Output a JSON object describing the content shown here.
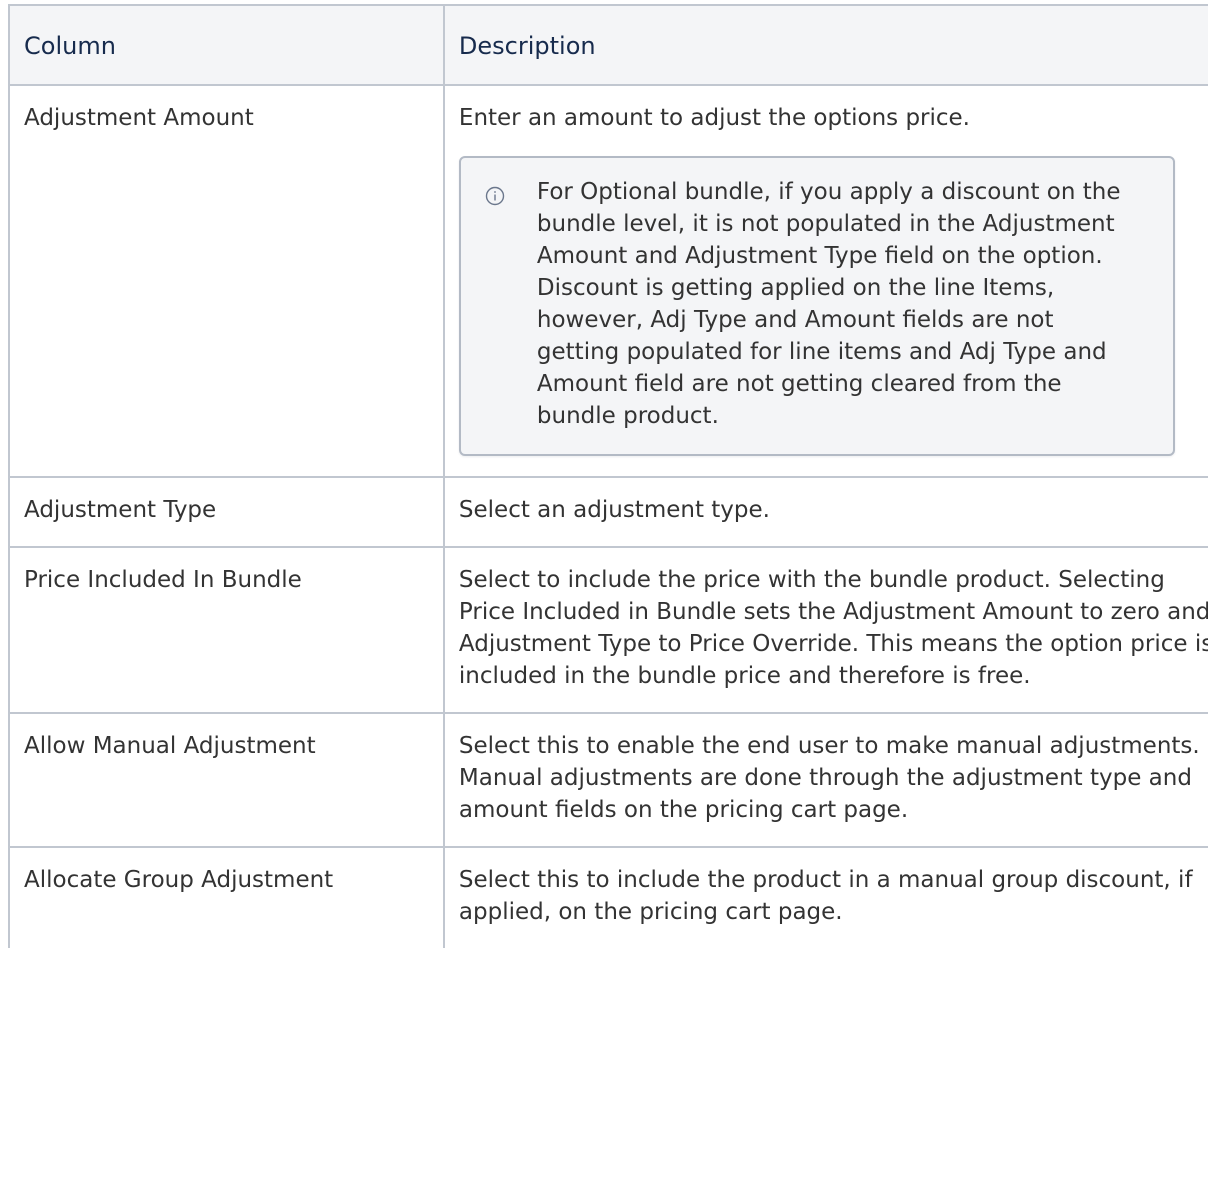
{
  "table": {
    "headers": [
      "Column",
      "Description"
    ],
    "rows": [
      {
        "column": "Adjustment Amount",
        "description": "Enter an amount to adjust the options price.",
        "note": {
          "icon": "info-icon",
          "paragraphs": [
            "For Optional bundle, if you apply a discount on the bundle level, it is not populated in the Adjustment Amount and Adjustment Type field on the option.",
            "Discount is getting applied on the line Items, however, Adj Type and Amount fields are not getting populated for line items and Adj Type and Amount field are not getting cleared from the bundle product."
          ]
        }
      },
      {
        "column": "Adjustment Type",
        "description": "Select an adjustment type."
      },
      {
        "column": "Price Included In Bundle",
        "description": "Select to include the price with the bundle product. Selecting Price Included in Bundle sets the Adjustment Amount to zero and Adjustment Type to Price Override. This means the option price is included in the bundle price and therefore is free."
      },
      {
        "column": "Allow Manual Adjustment",
        "description": "Select this to enable the end user to make manual adjustments. Manual adjustments are done through the adjustment type and amount fields on the pricing cart page."
      },
      {
        "column": "Allocate Group Adjustment",
        "description": "Select this to include the product in a manual group discount, if applied, on the pricing cart page."
      }
    ]
  },
  "colors": {
    "border": "#c1c7d0",
    "header_bg": "#f4f5f7",
    "note_bg": "#f4f5f7",
    "note_border": "#b3bac5",
    "text": "#333333"
  }
}
